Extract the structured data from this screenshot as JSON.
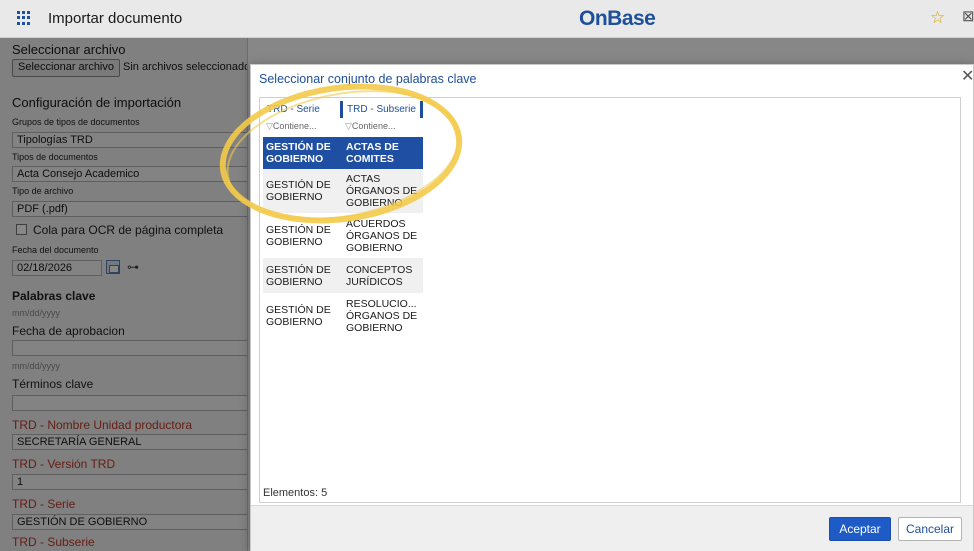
{
  "topbar": {
    "app_title": "Importar documento",
    "brand": "OnBase",
    "brand_mark": "·",
    "grid_icon": "apps-grid-icon",
    "star_icon": "star-icon",
    "edge_icon": "panel-icon"
  },
  "left": {
    "select_file_title": "Seleccionar archivo",
    "select_file_button": "Seleccionar archivo",
    "no_file_text": "Sin archivos seleccionados",
    "import_config_title": "Configuración de importación",
    "doc_type_groups_label": "Grupos de tipos de documentos",
    "doc_type_groups_value": "Tipologías TRD",
    "doc_types_label": "Tipos de documentos",
    "doc_types_value": "Acta Consejo Academico",
    "file_type_label": "Tipo de archivo",
    "file_type_value": "PDF (.pdf)",
    "ocr_label": "Cola para OCR de página completa",
    "doc_date_label": "Fecha del documento",
    "doc_date_value": "02/18/2026",
    "keywords_title": "Palabras clave",
    "date_hint_1": "mm/dd/yyyy",
    "approval_date_label": "Fecha de aprobacion",
    "approval_date_value": "",
    "date_hint_2": "mm/dd/yyyy",
    "key_terms_label": "Términos clave",
    "key_terms_value": "",
    "unit_label": "TRD - Nombre Unidad productora",
    "unit_value": "SECRETARÍA GENERAL",
    "version_label": "TRD - Versión TRD",
    "version_value": "1",
    "serie_label": "TRD - Serie",
    "serie_value": "GESTIÓN DE GOBIERNO",
    "subserie_label": "TRD - Subserie"
  },
  "modal": {
    "title": "Seleccionar conjunto de palabras clave",
    "close_icon": "close-icon",
    "columns": [
      "TRD - Serie",
      "TRD - Subserie"
    ],
    "filter_placeholder": [
      "Contiene...",
      "Contiene..."
    ],
    "filter_icon": "filter-icon",
    "rows": [
      {
        "serie": "GESTIÓN DE GOBIERNO",
        "subserie": "ACTAS DE COMITES",
        "selected": true
      },
      {
        "serie": "GESTIÓN DE GOBIERNO",
        "subserie": "ACTAS ÓRGANOS DE GOBIERNO",
        "selected": false
      },
      {
        "serie": "GESTIÓN DE GOBIERNO",
        "subserie": "ACUERDOS ÓRGANOS DE GOBIERNO",
        "selected": false
      },
      {
        "serie": "GESTIÓN DE GOBIERNO",
        "subserie": "CONCEPTOS JURÍDICOS",
        "selected": false
      },
      {
        "serie": "GESTIÓN DE GOBIERNO",
        "subserie": "RESOLUCIO... ÓRGANOS DE GOBIERNO",
        "selected": false
      }
    ],
    "count_label": "Elementos: 5",
    "accept_label": "Aceptar",
    "cancel_label": "Cancelar"
  },
  "colors": {
    "brand": "#1e4f9a",
    "selection": "#1f4fa3",
    "primary_button": "#1e5bc6",
    "required_label": "#c0392b",
    "annotation": "#f3ca4a"
  }
}
